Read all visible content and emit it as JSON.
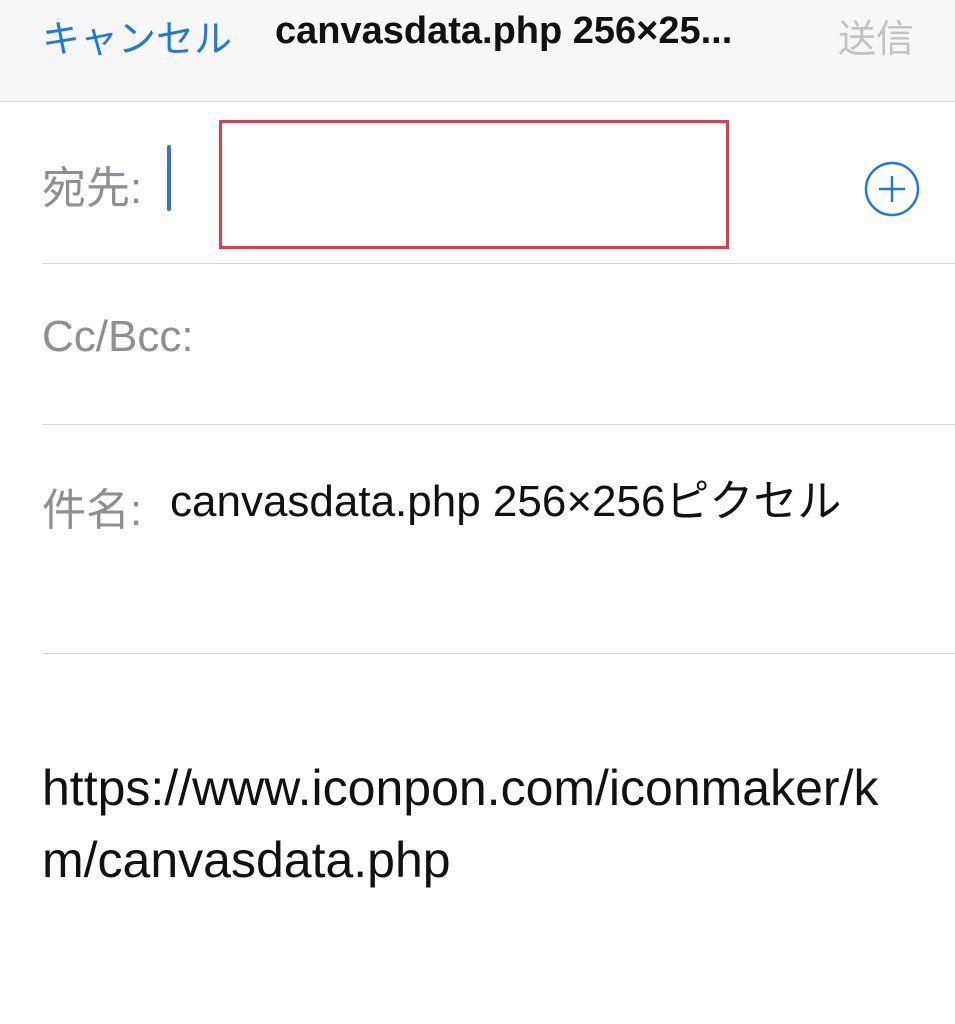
{
  "navbar": {
    "cancel_label": "キャンセル",
    "title": "canvasdata.php 256×25...",
    "send_label": "送信"
  },
  "fields": {
    "to": {
      "label": "宛先:",
      "value": "",
      "add_icon": "plus-circle-icon"
    },
    "cc_bcc": {
      "label": "Cc/Bcc:"
    },
    "subject": {
      "label": "件名:",
      "value": "canvasdata.php 256×256ピクセル"
    }
  },
  "body": {
    "text": "https://www.iconpon.com/iconmaker/km/canvasdata.php"
  },
  "colors": {
    "accent": "#1f7ad6",
    "label_gray": "#8e8e93",
    "disabled_gray": "#c2c2c2",
    "highlight_red": "#e03c4e",
    "cursor_blue": "#3a6fd8"
  }
}
